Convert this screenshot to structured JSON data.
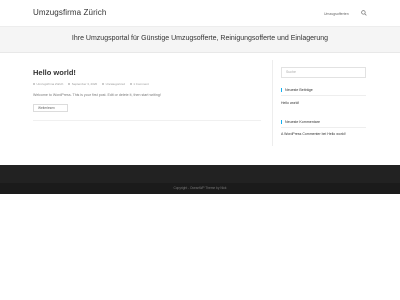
{
  "header": {
    "site_title": "Umzugsfirma Zürich",
    "nav_item": "Umzugsofferten"
  },
  "hero": {
    "title": "Ihre Umzugsportal für Günstige Umzugsofferte, Reinigungsofferte und Einlagerung"
  },
  "post": {
    "title": "Hello world!",
    "meta": {
      "author": "Umzugsfirma Zürich",
      "date": "September 3, 2020",
      "category": "Uncategorized",
      "comments": "1 Comment"
    },
    "excerpt": "Welcome to WordPress. This is your first post. Edit or delete it, then start writing!",
    "more_button": "Weiterlesen"
  },
  "sidebar": {
    "search_placeholder": "Suche",
    "recent_posts": {
      "title": "Neueste Beiträge",
      "items": [
        "Hello world!"
      ]
    },
    "recent_comments": {
      "title": "Neueste Kommentare",
      "items": [
        {
          "author": "A WordPress Commenter",
          "connector": "bei",
          "post": "Hello world!"
        }
      ]
    }
  },
  "footer": {
    "copyright": "Copyright - OceanWP Theme by Nick"
  },
  "colors": {
    "accent": "#13aff0",
    "footer_bg": "#222222",
    "hero_bg": "#f5f5f5"
  }
}
